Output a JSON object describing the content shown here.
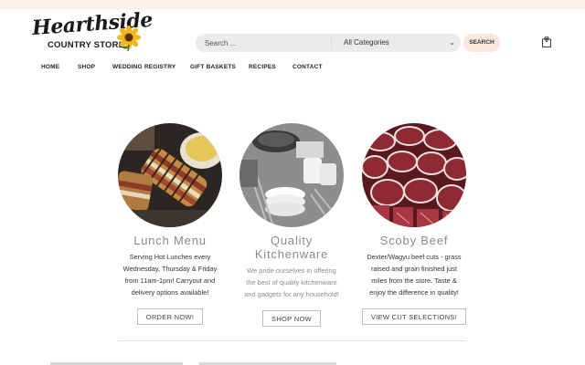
{
  "logo": {
    "script_text": "Hearthside",
    "sub_text": "COUNTRY STORE"
  },
  "search": {
    "placeholder": "Search ...",
    "category_selected": "All Categories",
    "button_label": "SEARCH"
  },
  "cart": {
    "count": "0",
    "icon": "shopping-bag-icon"
  },
  "nav": {
    "items": [
      "HOME",
      "SHOP",
      "WEDDING REGISTRY",
      "GIFT BASKETS",
      "RECIPES",
      "CONTACT"
    ]
  },
  "cards": [
    {
      "title": "Lunch Menu",
      "description": [
        "Serving Hot Lunches every",
        "Wednesday, Thursday & Friday",
        "from 11am-1pm! Carryout and",
        "delivery options available!"
      ],
      "button_label": "ORDER NOW!"
    },
    {
      "title": [
        "Quality",
        "Kitchenware"
      ],
      "description": [
        "We pride ourselves in offering",
        "the best of quality kitchenware",
        "and gadgets for any household!"
      ],
      "button_label": "SHOP NOW"
    },
    {
      "title": "Scoby Beef",
      "description": [
        "Dexter/Wagyu beef cuts - grass",
        "raised and grain finished just",
        "miles from the store. Taste &",
        "enjoy the difference in quality!"
      ],
      "button_label": "VIEW CUT SELECTIONS!"
    }
  ],
  "colors": {
    "topbar": "#fbf1e8",
    "search_bg": "#ebebeb",
    "search_button_bg": "#fbe7dc",
    "card_title": "#8a8a8a"
  }
}
